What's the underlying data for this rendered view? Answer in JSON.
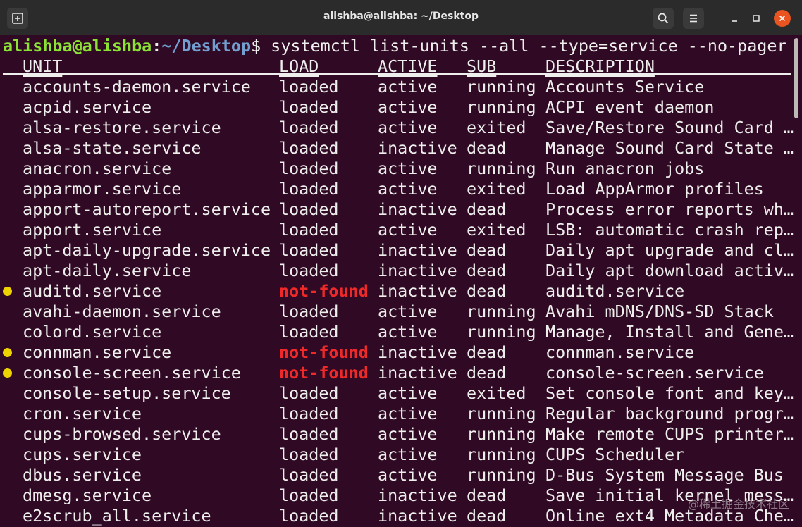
{
  "window": {
    "title": "alishba@alishba: ~/Desktop"
  },
  "prompt": {
    "user": "alishba@alishba",
    "colon": ":",
    "path": "~/Desktop",
    "symbol": "$",
    "command": " systemctl list-units --all --type=service --no-pager"
  },
  "table": {
    "headers": {
      "unit": "UNIT",
      "load": "LOAD",
      "active": "ACTIVE",
      "sub": "SUB",
      "description": "DESCRIPTION"
    },
    "rows": [
      {
        "unit": "accounts-daemon.service",
        "load": "loaded",
        "active": "active",
        "sub": "running",
        "description": "Accounts Service"
      },
      {
        "unit": "acpid.service",
        "load": "loaded",
        "active": "active",
        "sub": "running",
        "description": "ACPI event daemon"
      },
      {
        "unit": "alsa-restore.service",
        "load": "loaded",
        "active": "active",
        "sub": "exited",
        "description": "Save/Restore Sound Card …"
      },
      {
        "unit": "alsa-state.service",
        "load": "loaded",
        "active": "inactive",
        "sub": "dead",
        "description": "Manage Sound Card State …"
      },
      {
        "unit": "anacron.service",
        "load": "loaded",
        "active": "active",
        "sub": "running",
        "description": "Run anacron jobs"
      },
      {
        "unit": "apparmor.service",
        "load": "loaded",
        "active": "active",
        "sub": "exited",
        "description": "Load AppArmor profiles"
      },
      {
        "unit": "apport-autoreport.service",
        "load": "loaded",
        "active": "inactive",
        "sub": "dead",
        "description": "Process error reports wh…"
      },
      {
        "unit": "apport.service",
        "load": "loaded",
        "active": "active",
        "sub": "exited",
        "description": "LSB: automatic crash rep…"
      },
      {
        "unit": "apt-daily-upgrade.service",
        "load": "loaded",
        "active": "inactive",
        "sub": "dead",
        "description": "Daily apt upgrade and cl…"
      },
      {
        "unit": "apt-daily.service",
        "load": "loaded",
        "active": "inactive",
        "sub": "dead",
        "description": "Daily apt download activ…"
      },
      {
        "unit": "auditd.service",
        "load": "not-found",
        "active": "inactive",
        "sub": "dead",
        "description": "auditd.service",
        "marker": true
      },
      {
        "unit": "avahi-daemon.service",
        "load": "loaded",
        "active": "active",
        "sub": "running",
        "description": "Avahi mDNS/DNS-SD Stack"
      },
      {
        "unit": "colord.service",
        "load": "loaded",
        "active": "active",
        "sub": "running",
        "description": "Manage, Install and Gene…"
      },
      {
        "unit": "connman.service",
        "load": "not-found",
        "active": "inactive",
        "sub": "dead",
        "description": "connman.service",
        "marker": true
      },
      {
        "unit": "console-screen.service",
        "load": "not-found",
        "active": "inactive",
        "sub": "dead",
        "description": "console-screen.service",
        "marker": true
      },
      {
        "unit": "console-setup.service",
        "load": "loaded",
        "active": "active",
        "sub": "exited",
        "description": "Set console font and key…"
      },
      {
        "unit": "cron.service",
        "load": "loaded",
        "active": "active",
        "sub": "running",
        "description": "Regular background progr…"
      },
      {
        "unit": "cups-browsed.service",
        "load": "loaded",
        "active": "active",
        "sub": "running",
        "description": "Make remote CUPS printer…"
      },
      {
        "unit": "cups.service",
        "load": "loaded",
        "active": "active",
        "sub": "running",
        "description": "CUPS Scheduler"
      },
      {
        "unit": "dbus.service",
        "load": "loaded",
        "active": "active",
        "sub": "running",
        "description": "D-Bus System Message Bus"
      },
      {
        "unit": "dmesg.service",
        "load": "loaded",
        "active": "inactive",
        "sub": "dead",
        "description": "Save initial kernel mess…"
      },
      {
        "unit": "e2scrub_all.service",
        "load": "loaded",
        "active": "inactive",
        "sub": "dead",
        "description": "Online ext4 Metadata Che…"
      }
    ]
  },
  "watermark": "@稀土掘金技术社区",
  "icons": {
    "new_tab": "new-tab-icon",
    "search": "search-icon",
    "menu": "hamburger-menu-icon",
    "minimize": "minimize-icon",
    "maximize": "maximize-icon",
    "close": "close-icon"
  },
  "colors": {
    "background": "#300a24",
    "prompt_user": "#8ae234",
    "prompt_path": "#729fcf",
    "not_found": "#ef2929",
    "marker": "#edd400",
    "close_button": "#e95420"
  }
}
